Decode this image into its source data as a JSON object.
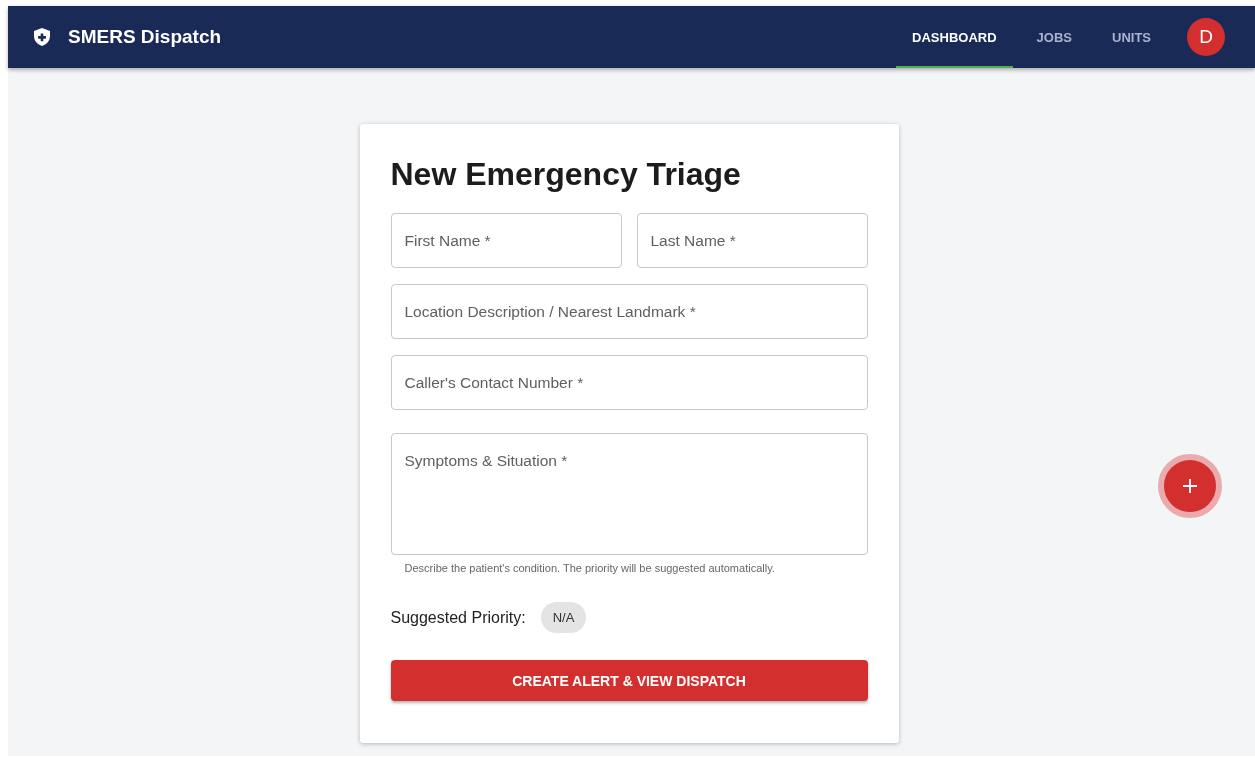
{
  "app_bar": {
    "title": "SMERS Dispatch",
    "nav": [
      {
        "label": "DASHBOARD",
        "selected": true
      },
      {
        "label": "JOBS",
        "selected": false
      },
      {
        "label": "UNITS",
        "selected": false
      }
    ],
    "avatar": "D"
  },
  "form": {
    "title": "New Emergency Triage",
    "fields": [
      {
        "kind": "half",
        "placeholder": "First Name *"
      },
      {
        "kind": "half",
        "placeholder": "Last Name *"
      },
      {
        "kind": "full",
        "placeholder": "Location Description / Nearest Landmark *"
      },
      {
        "kind": "full",
        "placeholder": "Caller's Contact Number *"
      },
      {
        "kind": "multiline",
        "placeholder": "Symptoms & Situation *",
        "helper": "Describe the patient's condition. The priority will be suggested automatically."
      }
    ],
    "priority_label": "Suggested Priority:",
    "priority_value": "N/A",
    "submit": "CREATE ALERT & VIEW DISPATCH"
  }
}
